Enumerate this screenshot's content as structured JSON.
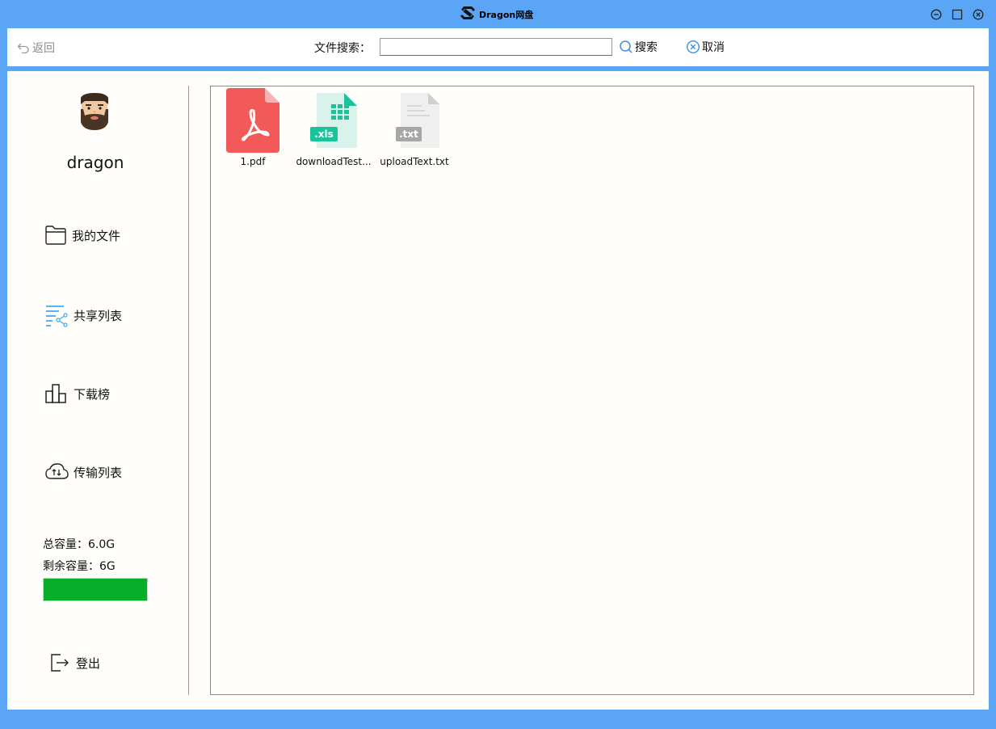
{
  "window": {
    "title": "Dragon网盘",
    "controls": [
      "minimize-icon",
      "maximize-icon",
      "close-icon"
    ]
  },
  "toolbar": {
    "back_label": "返回",
    "search_label": "文件搜索：",
    "search_value": "",
    "search_button": "搜索",
    "cancel_button": "取消"
  },
  "user": {
    "name": "dragon",
    "avatar_icon": "bearded-man-avatar"
  },
  "sidebar": {
    "items": [
      {
        "label": "我的文件",
        "icon": "folder-icon"
      },
      {
        "label": "共享列表",
        "icon": "share-list-icon"
      },
      {
        "label": "下载榜",
        "icon": "bar-chart-icon"
      },
      {
        "label": "传输列表",
        "icon": "cloud-transfer-icon"
      }
    ],
    "capacity": {
      "total_label": "总容量：6.0G",
      "remaining_label": "剩余容量：6G",
      "remaining_fraction": 1.0,
      "bar_color": "#06ae2a"
    },
    "logout_label": "登出"
  },
  "files": [
    {
      "name": "1.pdf",
      "type": "pdf",
      "color": "#f25a5a"
    },
    {
      "name": "downloadTest...",
      "type": "xls",
      "badge": ".xls",
      "color": "#1cc39a"
    },
    {
      "name": "uploadText.txt",
      "type": "txt",
      "badge": ".txt",
      "color": "#a6a6a6"
    }
  ],
  "colors": {
    "frame": "#5aa5f5",
    "panel": "#fffefa",
    "accent_blue": "#3a8ee6"
  }
}
